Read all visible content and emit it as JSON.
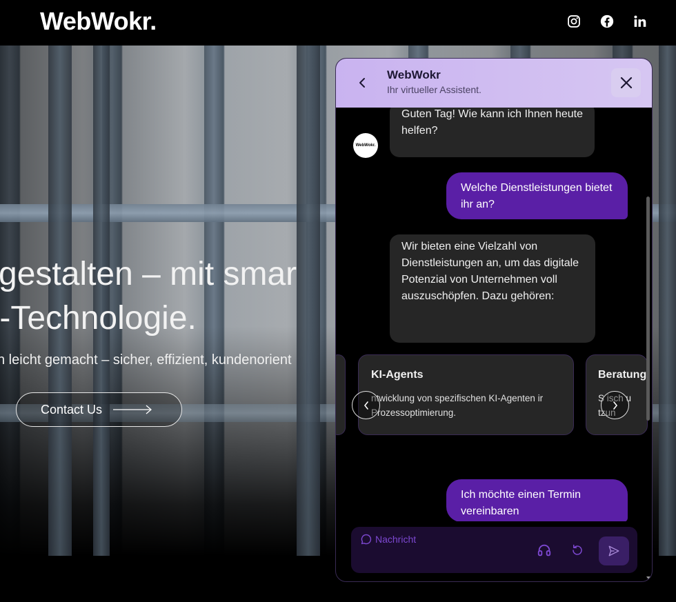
{
  "header": {
    "logo": "WebWokr.",
    "social_icons": [
      "instagram-icon",
      "facebook-icon",
      "linkedin-icon"
    ]
  },
  "hero": {
    "title_line1": "gestalten – mit smar",
    "title_line2": "I-Technologie.",
    "subtitle": "n leicht gemacht – sicher, effizient, kundenorient",
    "cta_label": "Contact Us"
  },
  "chat": {
    "name": "WebWokr",
    "tagline": "Ihr virtueller Assistent.",
    "avatar_text": "WebWokr.",
    "messages": [
      {
        "role": "bot",
        "text": "Guten Tag! Wie kann ich Ihnen heute helfen?"
      },
      {
        "role": "user",
        "text": "Welche Dienstleistungen bietet ihr an?"
      },
      {
        "role": "bot",
        "text": "Wir bieten eine Vielzahl von Dienstleistungen an, um das digitale Potenzial von Unternehmen voll auszuschöpfen. Dazu gehören:"
      },
      {
        "role": "user",
        "text": "Ich möchte einen Termin vereinbaren"
      }
    ],
    "cards": [
      {
        "title": "KI-Agents",
        "desc": "ntwicklung von spezifischen KI-Agenten ir Prozessoptimierung."
      },
      {
        "title": "Beratung",
        "desc": "S isch u tzun"
      }
    ],
    "input_placeholder": "Nachricht"
  },
  "colors": {
    "accent": "#5a1fa6",
    "header_bg": "#d2bff2",
    "bot_bubble": "#262626",
    "input_bg": "#1b0c30"
  }
}
